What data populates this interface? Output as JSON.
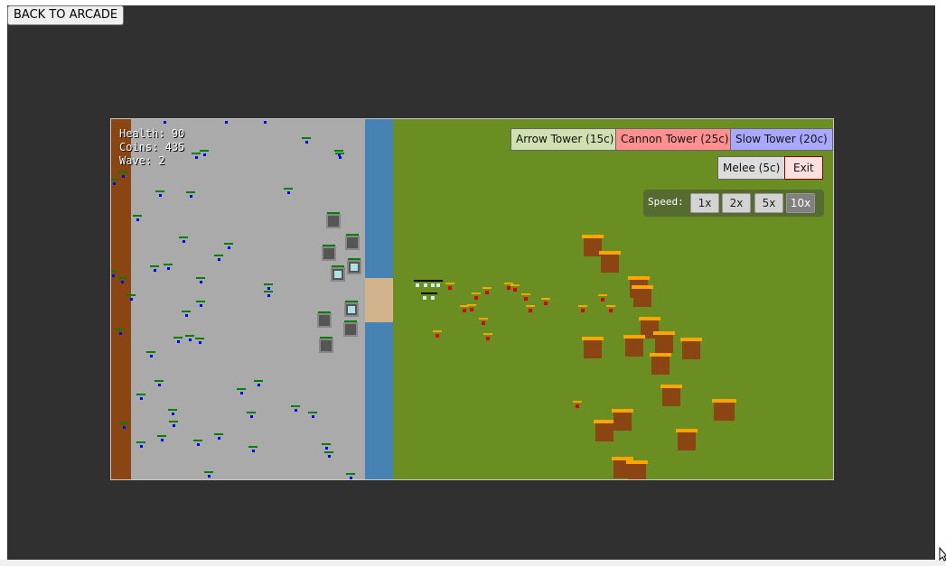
{
  "back_button": "BACK TO ARCADE",
  "hud": {
    "health_label": "Health:",
    "health": "90",
    "coins_label": "Coins:",
    "coins": "435",
    "wave_label": "Wave:",
    "wave": "2"
  },
  "shop": {
    "arrow_tower": "Arrow Tower (15c)",
    "cannon_tower": "Cannon Tower (25c)",
    "slow_tower": "Slow Tower (20c)",
    "melee": "Melee (5c)",
    "exit": "Exit"
  },
  "speed": {
    "label": "Speed:",
    "options": [
      "1x",
      "2x",
      "5x",
      "10x"
    ],
    "selected": "10x"
  },
  "colors": {
    "frame": "#303030",
    "road": "#aaaaaa",
    "dirt": "#8b4513",
    "river": "#4682b4",
    "bridge": "#d2b48c",
    "field": "#6b8e23",
    "hut": "#8b4513",
    "roof": "#ffa500",
    "enemy": "#dd0000",
    "ally": "#0000ff",
    "hp_bar": "#008000",
    "arrow_btn": "#d0e0b0",
    "cannon_btn": "#ff9090",
    "slow_btn": "#a8a8ff",
    "melee_btn": "#dcdcdc",
    "exit_btn": "#ffe0e0"
  },
  "icons": [
    "pointer-cursor-icon"
  ]
}
